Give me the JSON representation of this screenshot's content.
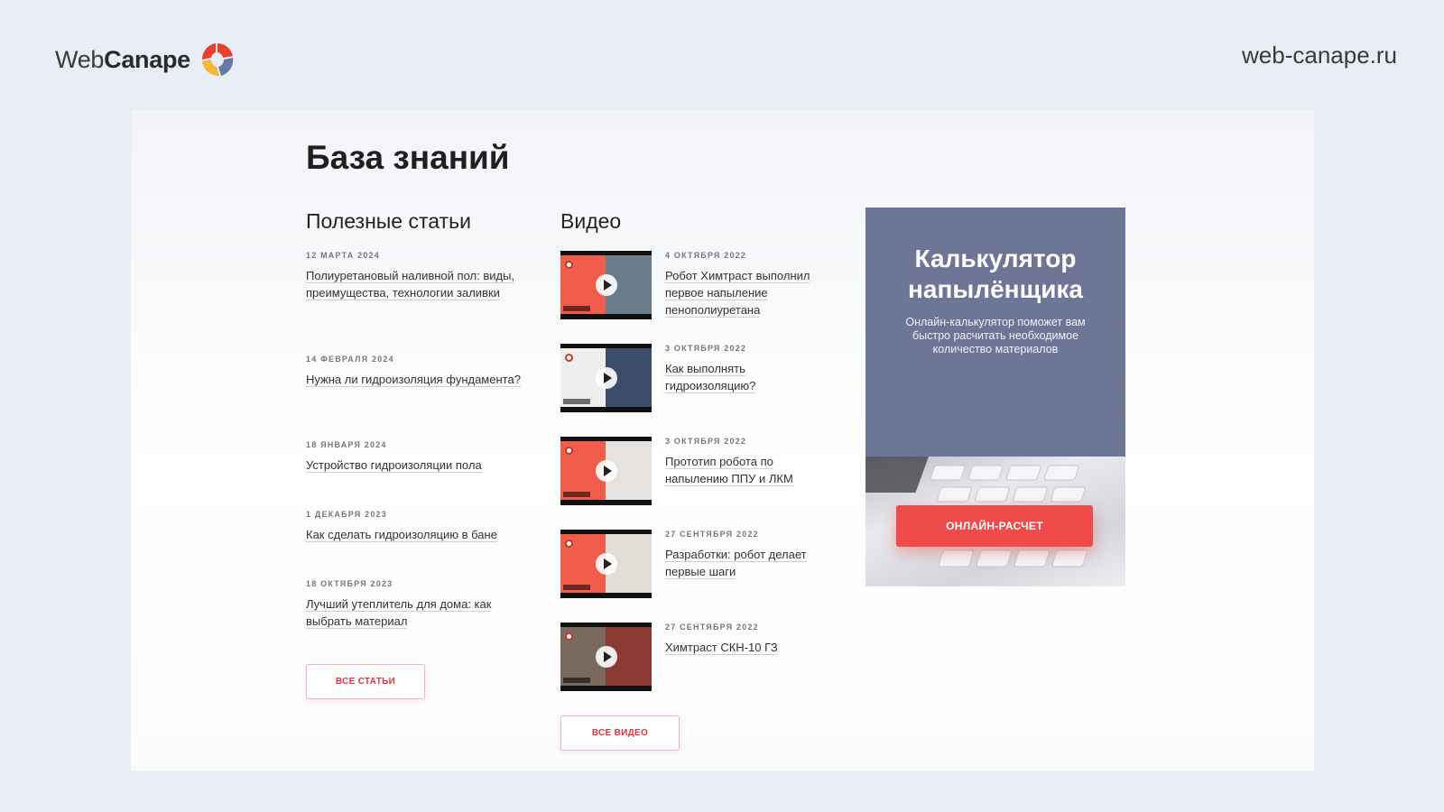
{
  "brand": {
    "name_light": "Web",
    "name_bold": "Canape",
    "site_url": "web-canape.ru"
  },
  "page": {
    "title": "База знаний"
  },
  "articles": {
    "title": "Полезные статьи",
    "items": [
      {
        "date": "12 МАРТА 2024",
        "title": "Полиуретановый наливной пол: виды, преимущества, технологии заливки"
      },
      {
        "date": "14 ФЕВРАЛЯ 2024",
        "title": "Нужна ли гидроизоляция фундамента?"
      },
      {
        "date": "18 ЯНВАРЯ 2024",
        "title": "Устройство гидроизоляции пола"
      },
      {
        "date": "1 ДЕКАБРЯ 2023",
        "title": "Как сделать гидроизоляцию в бане"
      },
      {
        "date": "18 ОКТЯБРЯ 2023",
        "title": "Лучший утеплитель для дома: как выбрать материал"
      }
    ],
    "all_label": "ВСЕ СТАТЬИ"
  },
  "videos": {
    "title": "Видео",
    "items": [
      {
        "date": "4 ОКТЯБРЯ 2022",
        "title": "Робот Химтраст выполнил первое напыление пенополиуретана"
      },
      {
        "date": "3 ОКТЯБРЯ 2022",
        "title": "Как выполнять гидроизоляцию?"
      },
      {
        "date": "3 ОКТЯБРЯ 2022",
        "title": "Прототип робота по напылению ППУ и ЛКМ"
      },
      {
        "date": "27 СЕНТЯБРЯ 2022",
        "title": "Разработки: робот делает первые шаги"
      },
      {
        "date": "27 СЕНТЯБРЯ 2022",
        "title": "Химтраст СКН-10 ГЗ"
      }
    ],
    "all_label": "ВСЕ ВИДЕО"
  },
  "promo": {
    "title_line1": "Калькулятор",
    "title_line2": "напылёнщика",
    "description": "Онлайн-калькулятор поможет вам быстро расчитать необходимое количество материалов",
    "button_label": "ОНЛАЙН-РАСЧЕТ"
  },
  "colors": {
    "accent_red": "#f04b4b",
    "promo_bg": "#6d7696",
    "page_bg": "#e9edf5"
  },
  "icons": {
    "logo": "webcanape-swirl-icon",
    "play": "play-icon"
  }
}
